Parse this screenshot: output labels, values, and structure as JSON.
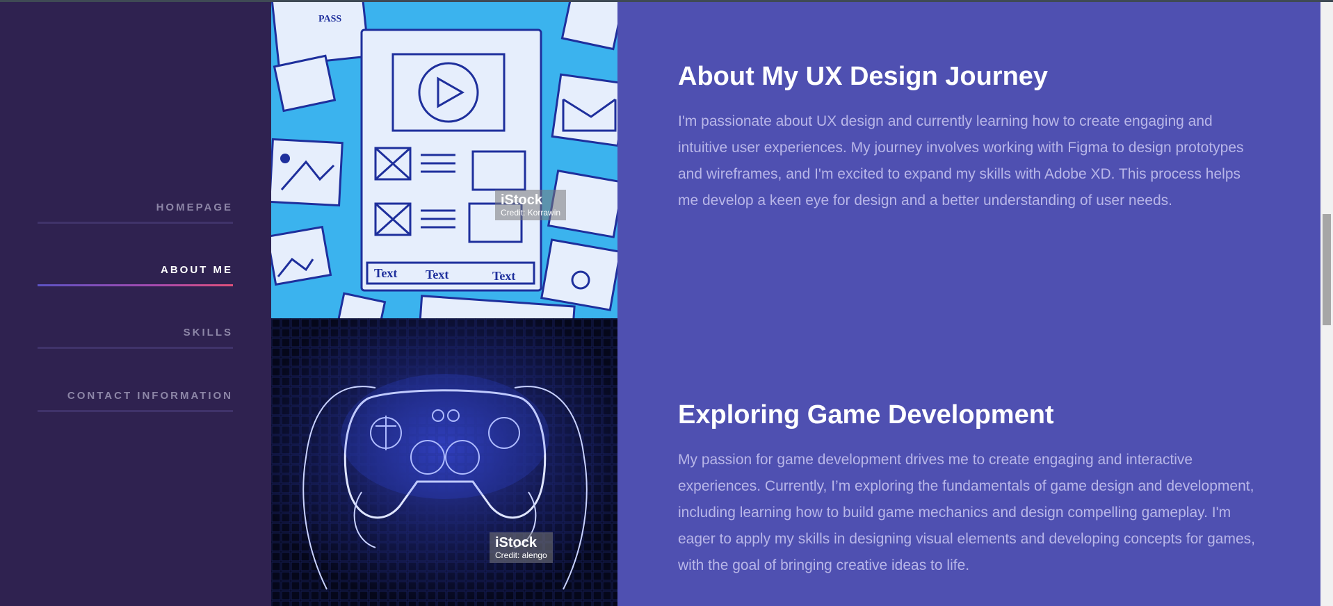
{
  "nav": {
    "items": [
      {
        "label": "HOMEPAGE",
        "active": false
      },
      {
        "label": "ABOUT ME",
        "active": true
      },
      {
        "label": "SKILLS",
        "active": false
      },
      {
        "label": "CONTACT INFORMATION",
        "active": false
      }
    ]
  },
  "images": {
    "ux": {
      "brand": "iStock",
      "credit": "Credit: Korrawin",
      "icon": "wireframe-sketch-image",
      "sketch_text": "Text",
      "badge_text": "PASS"
    },
    "game": {
      "brand": "iStock",
      "credit": "Credit: alengo",
      "icon": "gamepad-controller-image"
    }
  },
  "sections": {
    "ux": {
      "title": "About My UX Design Journey",
      "body": "I'm passionate about UX design and currently learning how to create engaging and intuitive user experiences. My journey involves working with Figma to design prototypes and wireframes, and I'm excited to expand my skills with Adobe XD. This process helps me develop a keen eye for design and a better understanding of user needs."
    },
    "game": {
      "title": "Exploring Game Development",
      "body": "My passion for game development drives me to create engaging and interactive experiences. Currently, I’m exploring the fundamentals of game design and development, including learning how to build game mechanics and design compelling gameplay. I'm eager to apply my skills in designing visual elements and developing concepts for games, with the goal of bringing creative ideas to life."
    }
  },
  "colors": {
    "sidebar_bg": "#2f2250",
    "main_bg": "#4f50b1",
    "nav_inactive": "#8d86a7",
    "nav_active": "#ffffff",
    "body_text": "#b8b6e8"
  }
}
